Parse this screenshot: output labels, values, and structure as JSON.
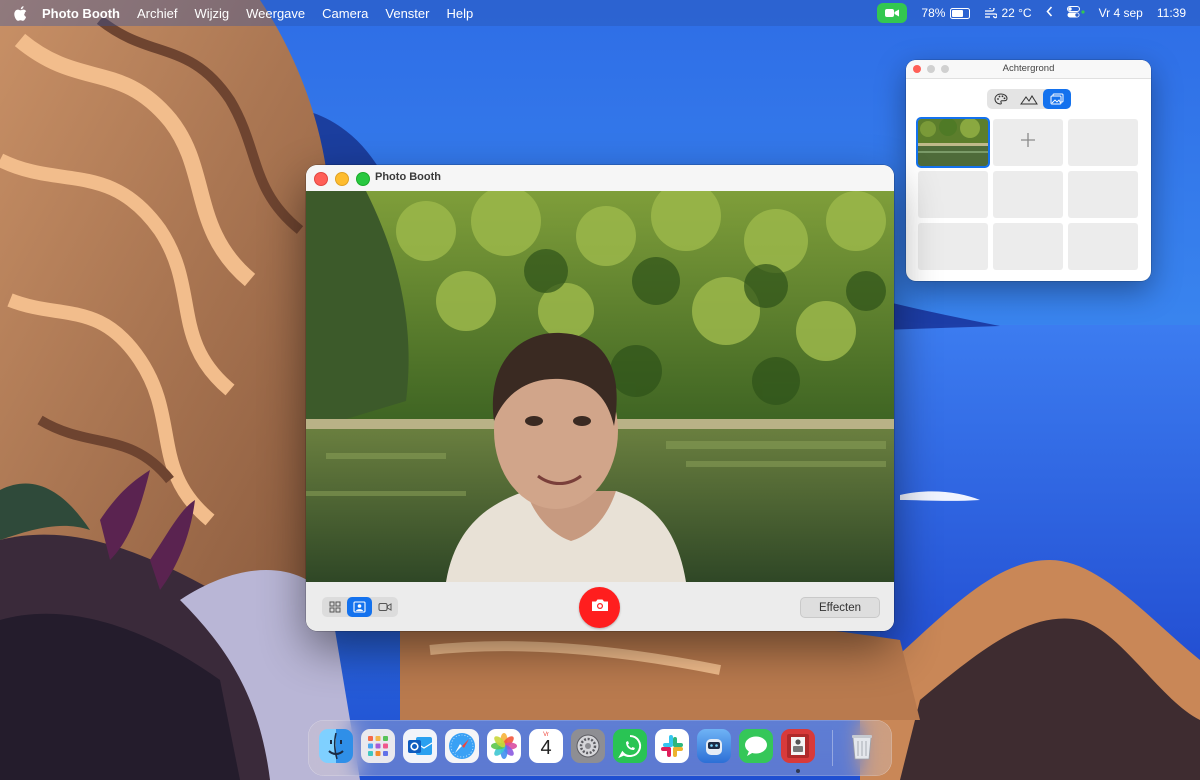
{
  "menubar": {
    "app_name": "Photo Booth",
    "menus": [
      "Archief",
      "Wijzig",
      "Weergave",
      "Camera",
      "Venster",
      "Help"
    ],
    "battery": "78%",
    "battery_level": 0.78,
    "temperature": "22 °C",
    "date": "Vr 4 sep",
    "time": "11:39",
    "colors": {
      "camera_indicator": "#33c750"
    }
  },
  "photo_booth": {
    "title": "Photo Booth",
    "modes": [
      "grid-icon",
      "portrait-photo-icon",
      "video-icon"
    ],
    "active_mode": "portrait-photo-icon",
    "shutter_icon": "camera-icon",
    "effects_label": "Effecten",
    "colors": {
      "shutter": "#ff1e1e",
      "accent": "#1472ee"
    }
  },
  "background_panel": {
    "title": "Achtergrond",
    "tabs": [
      "palette-icon",
      "landscape-icon",
      "photos-icon"
    ],
    "active_tab": "photos-icon",
    "add_label": "+"
  },
  "dock": {
    "apps": [
      "Finder",
      "Launchpad",
      "Outlook",
      "Safari",
      "Foto's",
      "Agenda",
      "Systeeminstellingen",
      "WhatsApp",
      "Slack",
      "Photo Booth extra",
      "Berichten",
      "Photo Booth",
      "Prullenmand"
    ],
    "calendar": {
      "weekday": "Vr",
      "day": "4"
    }
  }
}
